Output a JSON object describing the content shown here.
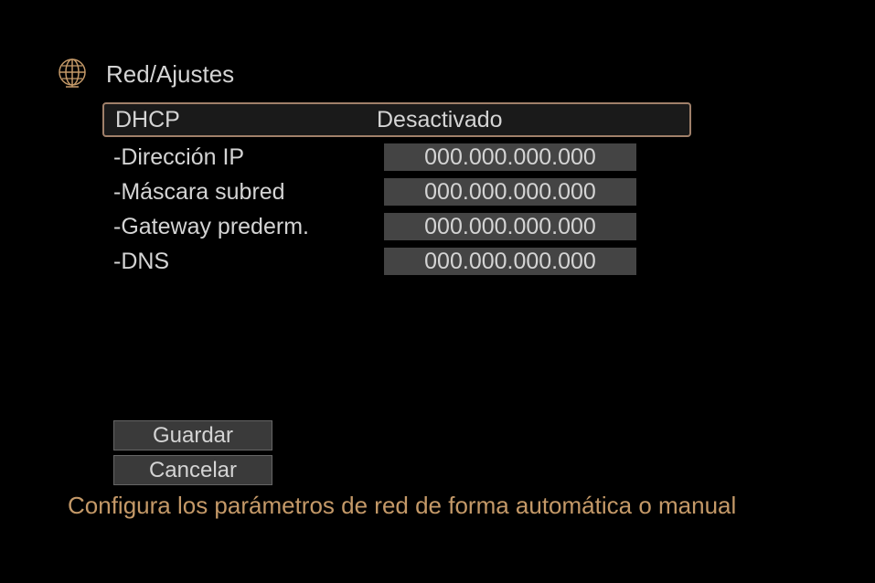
{
  "header": {
    "title": "Red/Ajustes"
  },
  "dhcp": {
    "label": "DHCP",
    "value": "Desactivado"
  },
  "fields": {
    "ip": {
      "label": "-Dirección IP",
      "value": "000.000.000.000"
    },
    "subnet": {
      "label": "-Máscara subred",
      "value": "000.000.000.000"
    },
    "gateway": {
      "label": "-Gateway prederm.",
      "value": "000.000.000.000"
    },
    "dns": {
      "label": "-DNS",
      "value": "000.000.000.000"
    }
  },
  "buttons": {
    "save": "Guardar",
    "cancel": "Cancelar"
  },
  "helpText": "Configura los parámetros de red de forma automática o manual"
}
